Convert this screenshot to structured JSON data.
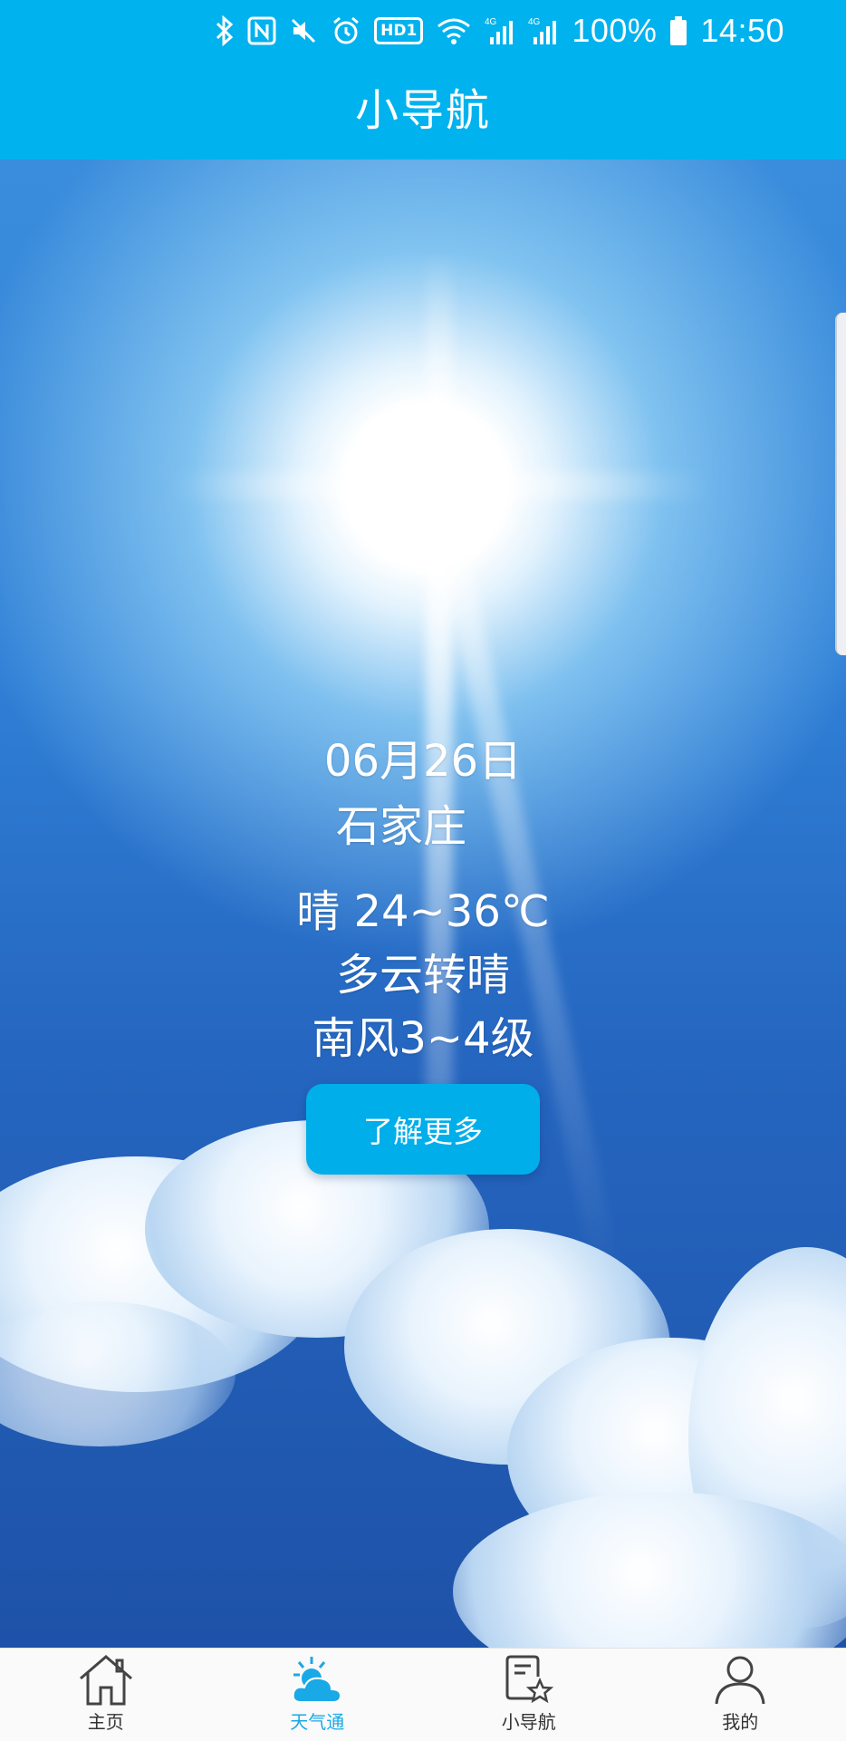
{
  "status_bar": {
    "icons": [
      "bluetooth-icon",
      "nfc-icon",
      "mute-icon",
      "alarm-icon",
      "hd-icon",
      "wifi-icon",
      "signal-4g-icon",
      "signal-4g-icon",
      "battery-icon"
    ],
    "hd_label": "HD1",
    "battery_percent": "100%",
    "time": "14:50"
  },
  "header": {
    "title": "小导航"
  },
  "weather": {
    "date": "06月26日",
    "city": "石家庄",
    "temperature": "晴 24~36℃",
    "condition": "多云转晴",
    "wind": "南风3~4级",
    "more_button": "了解更多"
  },
  "bottom_nav": {
    "items": [
      {
        "label": "主页",
        "icon": "home-icon",
        "active": false
      },
      {
        "label": "天气通",
        "icon": "weather-icon",
        "active": true
      },
      {
        "label": "小导航",
        "icon": "favorites-list-icon",
        "active": false
      },
      {
        "label": "我的",
        "icon": "profile-icon",
        "active": false
      }
    ]
  },
  "colors": {
    "accent": "#00b2ee",
    "active_tab": "#19a9e6",
    "button": "#00aeea"
  }
}
